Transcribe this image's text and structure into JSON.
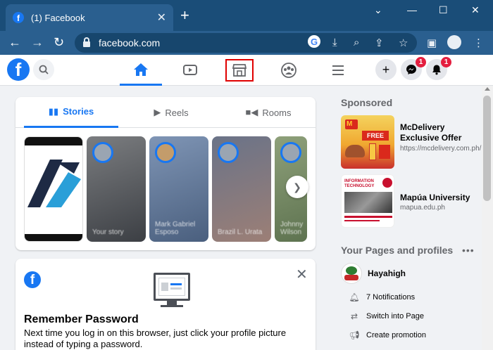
{
  "browser": {
    "tab_title": "(1) Facebook",
    "url": "facebook.com"
  },
  "fb_header": {
    "messenger_badge": "1",
    "notifications_badge": "1"
  },
  "stories": {
    "tabs": [
      {
        "label": "Stories",
        "active": true
      },
      {
        "label": "Reels",
        "active": false
      },
      {
        "label": "Rooms",
        "active": false
      }
    ],
    "items": [
      {
        "name": ""
      },
      {
        "name": "Your story"
      },
      {
        "name": "Mark Gabriel Esposo"
      },
      {
        "name": "Brazil L. Urata"
      },
      {
        "name": "Johnny Wilson"
      }
    ]
  },
  "remember_password": {
    "title": "Remember Password",
    "text": "Next time you log in on this browser, just click your profile picture instead of typing a password."
  },
  "sponsored": {
    "heading": "Sponsored",
    "ads": [
      {
        "title": "McDelivery Exclusive Offer",
        "url": "https://mcdelivery.com.ph/",
        "thumb_text": "FREE"
      },
      {
        "title": "Mapúa University",
        "url": "mapua.edu.ph",
        "thumb_text": "INFORMATION TECHNOLOGY"
      }
    ]
  },
  "pages": {
    "heading": "Your Pages and profiles",
    "page_name": "Hayahigh",
    "actions": [
      {
        "label": "7 Notifications",
        "icon": "bell-icon"
      },
      {
        "label": "Switch into Page",
        "icon": "switch-icon"
      },
      {
        "label": "Create promotion",
        "icon": "megaphone-icon"
      }
    ]
  },
  "colors": {
    "fb_blue": "#1877f2",
    "chrome_dark": "#1a4d78",
    "chrome_toolbar": "#2a5f8f",
    "highlight_red": "#e00000",
    "badge_red": "#e41e3f"
  }
}
